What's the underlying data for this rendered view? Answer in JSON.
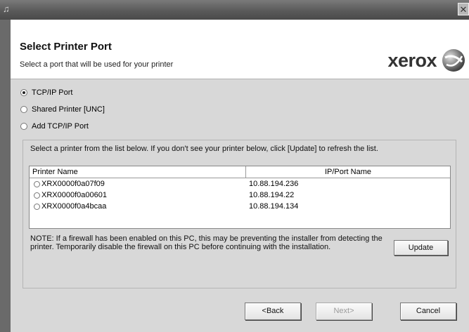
{
  "window": {
    "title_icon": "installer-icon",
    "close_label": "✕"
  },
  "header": {
    "title": "Select Printer Port",
    "subtitle": "Select a port that will be used for your printer",
    "logo_text": "xerox"
  },
  "port_options": [
    {
      "label": "TCP/IP Port",
      "selected": true
    },
    {
      "label": "Shared Printer [UNC]",
      "selected": false
    },
    {
      "label": "Add TCP/IP Port",
      "selected": false
    }
  ],
  "printer_list": {
    "instruction": "Select a printer from the list below. If you don't see your printer below, click [Update] to refresh the list.",
    "columns": [
      "Printer Name",
      "IP/Port Name"
    ],
    "rows": [
      {
        "name": "XRX0000f0a07f09",
        "ip": "10.88.194.236"
      },
      {
        "name": "XRX0000f0a00601",
        "ip": "10.88.194.22"
      },
      {
        "name": "XRX0000f0a4bcaa",
        "ip": "10.88.194.134"
      }
    ]
  },
  "note": "NOTE: If a firewall has been enabled on this PC, this may be preventing the installer from detecting the printer. Temporarily disable the firewall on this PC before continuing with the installation.",
  "buttons": {
    "update": "Update",
    "back": "<Back",
    "next": "Next>",
    "cancel": "Cancel"
  },
  "colors": {
    "titlebar": "#5a5a5a",
    "panel": "#d8d8d8",
    "header_bg": "#ffffff"
  }
}
